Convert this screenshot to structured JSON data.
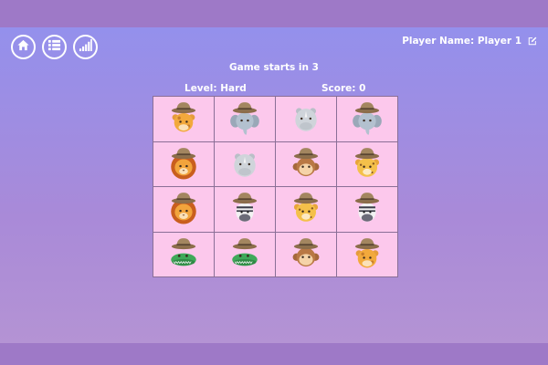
{
  "header": {
    "buttons": [
      {
        "name": "home-button",
        "icon": "home-icon"
      },
      {
        "name": "menu-button",
        "icon": "list-icon"
      },
      {
        "name": "stats-button",
        "icon": "signal-bars-icon"
      }
    ],
    "player_label": "Player Name: Player 1",
    "edit_icon": "edit-icon"
  },
  "game": {
    "countdown": "Game starts in 3",
    "level": "Level: Hard",
    "score": "Score: 0"
  },
  "board": {
    "rows": [
      [
        "giraffe",
        "elephant",
        "rhino",
        "elephant"
      ],
      [
        "lion",
        "rhino",
        "monkey",
        "leopard"
      ],
      [
        "lion",
        "zebra",
        "leopard",
        "zebra"
      ],
      [
        "crocodile",
        "crocodile",
        "monkey",
        "giraffe"
      ]
    ]
  },
  "colors": {
    "card": "#fcc8ec",
    "board_border": "#8a6f97",
    "background_top": "#9490ec",
    "background_bottom": "#b493d4",
    "frame": "#9e79c7"
  }
}
